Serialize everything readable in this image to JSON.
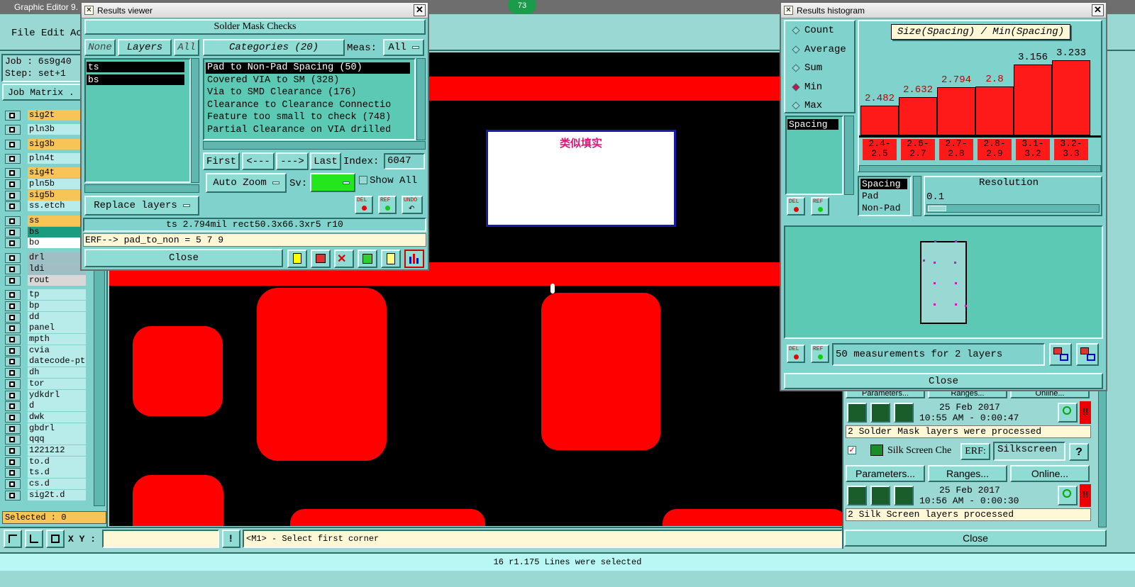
{
  "main": {
    "title": "Graphic Editor 9.",
    "badge": "73",
    "menu": [
      "File",
      "Edit",
      "Ac"
    ],
    "job": "Job : 6s9g40",
    "step": "Step: set+1",
    "job_matrix": "Job Matrix .",
    "layers": [
      "sig2t",
      "pln3b",
      "sig3b",
      "pln4t",
      "sig4t",
      "pln5b",
      "sig5b",
      "ss.etch",
      "ss",
      "bs",
      "bo",
      "drl",
      "ldi",
      "rout",
      "tp",
      "bp",
      "dd",
      "panel",
      "mpth",
      "cvia",
      "datecode-pt",
      "dh",
      "tor",
      "ydkdrl",
      "d",
      "dwk",
      "gbdrl",
      "qqq",
      "1221212",
      "to.d",
      "ts.d",
      "cs.d",
      "sig2t.d"
    ],
    "selected": "Selected : 0",
    "xy_label": "X Y :",
    "prompt": "<M1> - Select first corner",
    "status": "16 r1.175 Lines were selected",
    "annotation": "类似填实"
  },
  "results_viewer": {
    "title": "Results viewer",
    "header": "Solder Mask Checks",
    "none_btn": "None",
    "layers_btn": "Layers",
    "all_btn": "All",
    "layers": [
      "ts",
      "bs"
    ],
    "categories_btn": "Categories (20)",
    "meas_label": "Meas:",
    "meas_value": "All",
    "categories": [
      "Pad to Non-Pad Spacing (50)",
      "Covered VIA to SM (328)",
      "Via to SMD Clearance (176)",
      "Clearance to Clearance Connectio",
      "Feature too small to check (748)",
      "Partial Clearance on VIA drilled"
    ],
    "first": "First",
    "prev": "<---",
    "next": "--->",
    "last": "Last",
    "index_label": "Index:",
    "index_value": "6047",
    "auto_zoom": "Auto Zoom",
    "sv_label": "Sv:",
    "show_all": "Show All",
    "replace_layers": "Replace layers",
    "del": "DEL",
    "ref": "REF",
    "undo": "UNDO",
    "info": "ts 2.794mil  rect50.3x66.3xr5  r10",
    "erf": "ERF--> pad_to_non = 5 7 9",
    "close": "Close"
  },
  "histogram": {
    "title": "Results histogram",
    "modes": [
      "Count",
      "Average",
      "Sum",
      "Min",
      "Max"
    ],
    "selected_mode": "Min",
    "list_item": "Spacing",
    "measure_list": [
      "Spacing",
      "Pad",
      "Non-Pad"
    ],
    "resolution_label": "Resolution",
    "resolution_value": "0.1",
    "summary": "50 measurements for 2 layers",
    "del": "DEL",
    "ref": "REF",
    "close": "Close"
  },
  "chart_data": {
    "type": "bar",
    "title": "Size(Spacing) / Min(Spacing)",
    "categories": [
      "2.4-2.5",
      "2.6-2.7",
      "2.7-2.8",
      "2.8-2.9",
      "3.1-3.2",
      "3.2-3.3"
    ],
    "category_lines": [
      [
        "2.4-",
        "2.5"
      ],
      [
        "2.6-",
        "2.7"
      ],
      [
        "2.7-",
        "2.8"
      ],
      [
        "2.8-",
        "2.9"
      ],
      [
        "3.1-",
        "3.2"
      ],
      [
        "3.2-",
        "3.3"
      ]
    ],
    "values": [
      2.482,
      2.632,
      2.794,
      2.8,
      3.156,
      3.233
    ],
    "value_labels": [
      "2.482",
      "2.632",
      "2.794",
      "2.8",
      "3.156",
      "3.233"
    ],
    "xlabel": "",
    "ylabel": "",
    "bar_color": "#ff1a1a"
  },
  "checks": {
    "row1_buttons": [
      "Parameters...",
      "Ranges...",
      "Online..."
    ],
    "run1_date": "25 Feb 2017",
    "run1_time": "10:55 AM - 0:00:47",
    "run1_msg": "2 Solder Mask layers were processed",
    "silk_name": "Silk Screen Che",
    "erf_label": "ERF:",
    "erf_value": "Silkscreen",
    "help": "?",
    "row2_buttons": [
      "Parameters...",
      "Ranges...",
      "Online..."
    ],
    "run2_date": "25 Feb 2017",
    "run2_time": "10:56 AM - 0:00:30",
    "run2_msg": "2 Silk Screen layers processed",
    "close": "Close"
  }
}
